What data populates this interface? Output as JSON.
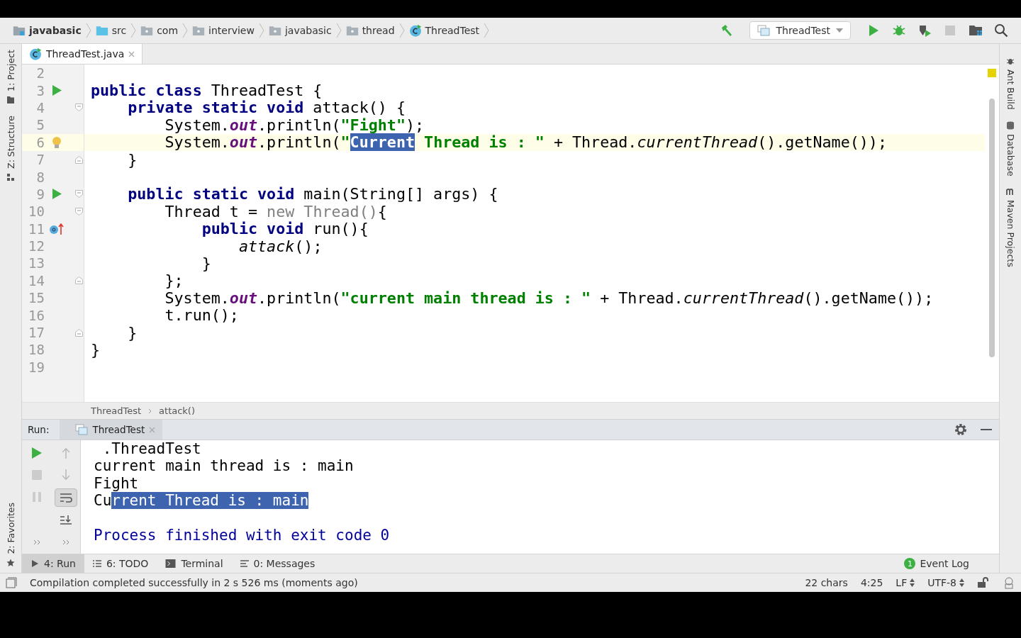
{
  "breadcrumbs": [
    {
      "label": "javabasic",
      "kind": "module"
    },
    {
      "label": "src",
      "kind": "source"
    },
    {
      "label": "com",
      "kind": "package"
    },
    {
      "label": "interview",
      "kind": "package"
    },
    {
      "label": "javabasic",
      "kind": "package"
    },
    {
      "label": "thread",
      "kind": "package"
    },
    {
      "label": "ThreadTest",
      "kind": "class"
    }
  ],
  "run_config": "ThreadTest",
  "editor_tabs": [
    {
      "label": "ThreadTest.java",
      "selected": true
    }
  ],
  "left_stripe": [
    {
      "label": "1: Project",
      "kind": "project"
    },
    {
      "label": "Z: Structure",
      "kind": "structure"
    }
  ],
  "left_stripe_bottom": [
    {
      "label": "2: Favorites",
      "kind": "favorites"
    }
  ],
  "right_stripe": [
    {
      "label": "Ant Build",
      "kind": "ant"
    },
    {
      "label": "Database",
      "kind": "database"
    },
    {
      "label": "Maven Projects",
      "kind": "maven"
    }
  ],
  "code_lines": [
    {
      "number": "2",
      "current": false
    },
    {
      "number": "3",
      "gutter_icon": {
        "kind": "run"
      },
      "current": false,
      "tokens": [
        {
          "text": "public class",
          "kind": "kw"
        },
        {
          "text": " ThreadTest {",
          "kind": "plain"
        }
      ]
    },
    {
      "number": "4",
      "fold_marker": {
        "kind": "open"
      },
      "current": false,
      "tokens": [
        {
          "text": "    private static void",
          "kind": "kw"
        },
        {
          "text": " attack() {",
          "kind": "plain"
        }
      ]
    },
    {
      "number": "5",
      "current": false,
      "tokens": [
        {
          "text": "        System.",
          "kind": "plain"
        },
        {
          "text": "out",
          "kind": "field"
        },
        {
          "text": ".println(",
          "kind": "plain"
        },
        {
          "text": "\"Fight\"",
          "kind": "str"
        },
        {
          "text": ");",
          "kind": "plain"
        }
      ]
    },
    {
      "number": "6",
      "gutter_icon": {
        "kind": "bulb"
      },
      "current": true,
      "tokens": [
        {
          "text": "        System.",
          "kind": "plain"
        },
        {
          "text": "out",
          "kind": "field"
        },
        {
          "text": ".println(",
          "kind": "plain"
        },
        {
          "text": "\"",
          "kind": "str"
        },
        {
          "text": "Current",
          "kind": "sel"
        },
        {
          "text": " Thread is : \"",
          "kind": "str"
        },
        {
          "text": " + Thread.",
          "kind": "plain"
        },
        {
          "text": "currentThread",
          "kind": "italic"
        },
        {
          "text": "().getName());",
          "kind": "plain"
        }
      ]
    },
    {
      "number": "7",
      "fold_marker": {
        "kind": "close"
      },
      "current": false,
      "tokens": [
        {
          "text": "    }",
          "kind": "plain"
        }
      ]
    },
    {
      "number": "8",
      "current": false
    },
    {
      "number": "9",
      "gutter_icon": {
        "kind": "run"
      },
      "fold_marker": {
        "kind": "open"
      },
      "current": false,
      "tokens": [
        {
          "text": "    public static void",
          "kind": "kw"
        },
        {
          "text": " main(String[] args) {",
          "kind": "plain"
        }
      ]
    },
    {
      "number": "10",
      "fold_marker": {
        "kind": "open"
      },
      "current": false,
      "tokens": [
        {
          "text": "        Thread t = ",
          "kind": "plain"
        },
        {
          "text": "new Thread()",
          "kind": "dim"
        },
        {
          "text": "{",
          "kind": "plain"
        }
      ]
    },
    {
      "number": "11",
      "gutter_icon": {
        "kind": "override"
      },
      "current": false,
      "tokens": [
        {
          "text": "            public void",
          "kind": "kw"
        },
        {
          "text": " run(){",
          "kind": "plain"
        }
      ]
    },
    {
      "number": "12",
      "current": false,
      "tokens": [
        {
          "text": "                attack",
          "kind": "italic"
        },
        {
          "text": "();",
          "kind": "plain"
        }
      ]
    },
    {
      "number": "13",
      "current": false,
      "tokens": [
        {
          "text": "            }",
          "kind": "plain"
        }
      ]
    },
    {
      "number": "14",
      "fold_marker": {
        "kind": "close"
      },
      "current": false,
      "tokens": [
        {
          "text": "        };",
          "kind": "plain"
        }
      ]
    },
    {
      "number": "15",
      "current": false,
      "tokens": [
        {
          "text": "        System.",
          "kind": "plain"
        },
        {
          "text": "out",
          "kind": "field"
        },
        {
          "text": ".println(",
          "kind": "plain"
        },
        {
          "text": "\"current main thread is : \"",
          "kind": "str"
        },
        {
          "text": " + Thread.",
          "kind": "plain"
        },
        {
          "text": "currentThread",
          "kind": "italic"
        },
        {
          "text": "().getName());",
          "kind": "plain"
        }
      ]
    },
    {
      "number": "16",
      "current": false,
      "tokens": [
        {
          "text": "        t.run();",
          "kind": "plain"
        }
      ]
    },
    {
      "number": "17",
      "fold_marker": {
        "kind": "close"
      },
      "current": false,
      "tokens": [
        {
          "text": "    }",
          "kind": "plain"
        }
      ]
    },
    {
      "number": "18",
      "current": false,
      "tokens": [
        {
          "text": "}",
          "kind": "plain"
        }
      ]
    },
    {
      "number": "19",
      "current": false
    }
  ],
  "code_breadcrumbs": [
    "ThreadTest",
    "attack()"
  ],
  "run_panel": {
    "label": "Run:",
    "tab": "ThreadTest",
    "console": [
      {
        "kind": "output",
        "tokens": [
          {
            "text": " .ThreadTest",
            "kind": "plain"
          }
        ]
      },
      {
        "kind": "output",
        "tokens": [
          {
            "text": "current main thread is : main",
            "kind": "plain"
          }
        ]
      },
      {
        "kind": "output",
        "tokens": [
          {
            "text": "Fight",
            "kind": "plain"
          }
        ]
      },
      {
        "kind": "output",
        "tokens": [
          {
            "text": "Cu",
            "kind": "plain"
          },
          {
            "text": "rrent Thread is : main",
            "kind": "sel"
          }
        ]
      },
      {
        "kind": "blank"
      },
      {
        "kind": "system",
        "tokens": [
          {
            "text": "Process finished with exit code 0",
            "kind": "plain"
          }
        ]
      }
    ]
  },
  "tool_tabs": [
    {
      "label": "4: Run",
      "kind": "run",
      "selected": true
    },
    {
      "label": "6: TODO",
      "kind": "todo",
      "selected": false
    },
    {
      "label": "Terminal",
      "kind": "terminal",
      "selected": false
    },
    {
      "label": "0: Messages",
      "kind": "messages",
      "selected": false
    }
  ],
  "event_log": {
    "label": "Event Log",
    "badge": "1"
  },
  "status": {
    "message": "Compilation completed successfully in 2 s 526 ms (moments ago)",
    "chars": "22 chars",
    "position": "4:25",
    "line_separator": "LF",
    "encoding": "UTF-8"
  }
}
